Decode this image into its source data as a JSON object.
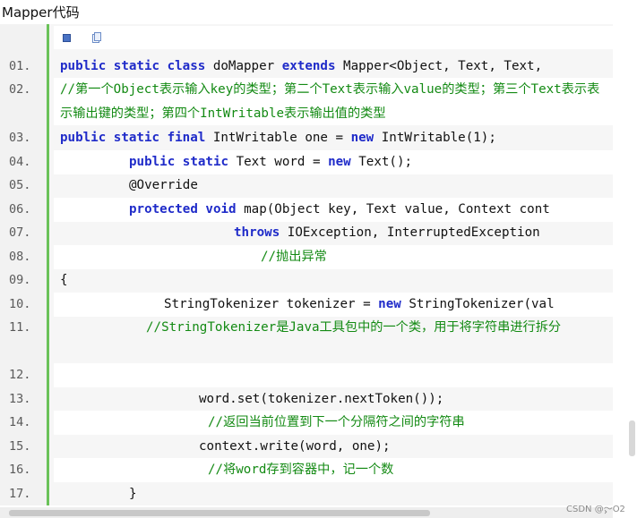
{
  "title": "Mapper代码",
  "toolbar": {
    "view_icon": "view-source-icon",
    "copy_icon": "copy-icon"
  },
  "lines": [
    {
      "num": "01.",
      "tokens": [
        {
          "t": "public static class",
          "c": "kw"
        },
        {
          "t": " doMapper ",
          "c": ""
        },
        {
          "t": "extends",
          "c": "kw"
        },
        {
          "t": " Mapper<Object, Text, Text,",
          "c": ""
        }
      ]
    },
    {
      "num": "02.",
      "tokens": [
        {
          "t": "//第一个Object表示输入key的类型；第二个Text表示输入value的类型；第三个Text表示表示输出键的类型；第四个IntWritable表示输出值的类型",
          "c": "cm"
        }
      ]
    },
    {
      "num": "03.",
      "tokens": [
        {
          "t": "public static final",
          "c": "kw"
        },
        {
          "t": " IntWritable one = ",
          "c": ""
        },
        {
          "t": "new",
          "c": "kw"
        },
        {
          "t": " IntWritable(1);",
          "c": ""
        }
      ]
    },
    {
      "num": "04.",
      "tokens": [
        {
          "t": "public static",
          "c": "kw"
        },
        {
          "t": " Text word = ",
          "c": ""
        },
        {
          "t": "new",
          "c": "kw"
        },
        {
          "t": " Text();",
          "c": ""
        }
      ]
    },
    {
      "num": "05.",
      "tokens": [
        {
          "t": "@Override",
          "c": ""
        }
      ]
    },
    {
      "num": "06.",
      "tokens": [
        {
          "t": "protected void",
          "c": "kw"
        },
        {
          "t": " map(Object key, Text value, Context cont",
          "c": ""
        }
      ]
    },
    {
      "num": "07.",
      "tokens": [
        {
          "t": "throws",
          "c": "kw"
        },
        {
          "t": " IOException, InterruptedException",
          "c": ""
        }
      ]
    },
    {
      "num": "08.",
      "tokens": [
        {
          "t": "//抛出异常",
          "c": "cm"
        }
      ]
    },
    {
      "num": "09.",
      "tokens": [
        {
          "t": "{",
          "c": ""
        }
      ]
    },
    {
      "num": "10.",
      "tokens": [
        {
          "t": "StringTokenizer tokenizer = ",
          "c": ""
        },
        {
          "t": "new",
          "c": "kw"
        },
        {
          "t": " StringTokenizer(val",
          "c": ""
        }
      ]
    },
    {
      "num": "11.",
      "tokens": [
        {
          "t": "//StringTokenizer是Java工具包中的一个类，用于将字符串进行拆分",
          "c": "cm"
        }
      ]
    },
    {
      "num": "12.",
      "tokens": []
    },
    {
      "num": "13.",
      "tokens": [
        {
          "t": "word.set(tokenizer.nextToken());",
          "c": ""
        }
      ]
    },
    {
      "num": "14.",
      "tokens": [
        {
          "t": "//返回当前位置到下一个分隔符之间的字符串",
          "c": "cm"
        }
      ]
    },
    {
      "num": "15.",
      "tokens": [
        {
          "t": "context.write(word, one);",
          "c": ""
        }
      ]
    },
    {
      "num": "16.",
      "tokens": [
        {
          "t": "//将word存到容器中，记一个数",
          "c": "cm"
        }
      ]
    },
    {
      "num": "17.",
      "tokens": [
        {
          "t": "}",
          "c": ""
        }
      ]
    }
  ],
  "watermark": "CSDN @～O2",
  "hscroll_arrow": "›"
}
